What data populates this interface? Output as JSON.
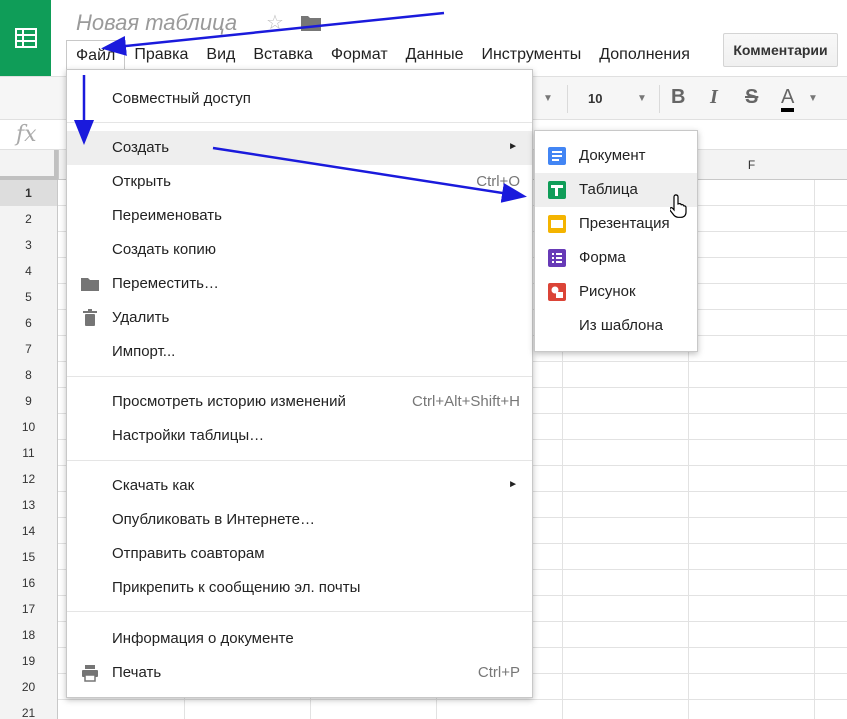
{
  "app": {
    "title": "Новая таблица"
  },
  "colors": {
    "sheets_green": "#0f9d58",
    "doc_blue": "#4285f4",
    "slides_yellow": "#f4b400",
    "forms_purple": "#673ab7",
    "drawing_red": "#db4437",
    "annotation_blue": "#1a1adc"
  },
  "menubar": {
    "items": [
      "Файл",
      "Правка",
      "Вид",
      "Вставка",
      "Формат",
      "Данные",
      "Инструменты",
      "Дополнения"
    ],
    "comments_label": "Комментарии"
  },
  "toolbar": {
    "font_size": "10",
    "bold": "B",
    "italic": "I",
    "strike": "S",
    "text_color": "A"
  },
  "formula_bar": {
    "fx_label": "fx"
  },
  "grid": {
    "column_headers": [
      "",
      "",
      "",
      "",
      "",
      "F"
    ],
    "row_numbers": [
      "1",
      "2",
      "3",
      "4",
      "5",
      "6",
      "7",
      "8",
      "9",
      "10",
      "11",
      "12",
      "13",
      "14",
      "15",
      "16",
      "17",
      "18",
      "19",
      "20",
      "21"
    ]
  },
  "file_menu": {
    "items": [
      {
        "label": "Совместный доступ",
        "shortcut": "",
        "icon": "",
        "submenu": false
      },
      {
        "label": "Создать",
        "shortcut": "",
        "icon": "",
        "submenu": true
      },
      {
        "label": "Открыть",
        "shortcut": "Ctrl+O",
        "icon": "",
        "submenu": false
      },
      {
        "label": "Переименовать",
        "shortcut": "",
        "icon": "",
        "submenu": false
      },
      {
        "label": "Создать копию",
        "shortcut": "",
        "icon": "",
        "submenu": false
      },
      {
        "label": "Переместить…",
        "shortcut": "",
        "icon": "folder-icon",
        "submenu": false
      },
      {
        "label": "Удалить",
        "shortcut": "",
        "icon": "trash-icon",
        "submenu": false
      },
      {
        "label": "Импорт...",
        "shortcut": "",
        "icon": "",
        "submenu": false
      },
      {
        "label": "Просмотреть историю изменений",
        "shortcut": "Ctrl+Alt+Shift+H",
        "icon": "",
        "submenu": false
      },
      {
        "label": "Настройки таблицы…",
        "shortcut": "",
        "icon": "",
        "submenu": false
      },
      {
        "label": "Скачать как",
        "shortcut": "",
        "icon": "",
        "submenu": true
      },
      {
        "label": "Опубликовать в Интернете…",
        "shortcut": "",
        "icon": "",
        "submenu": false
      },
      {
        "label": "Отправить соавторам",
        "shortcut": "",
        "icon": "",
        "submenu": false
      },
      {
        "label": "Прикрепить к сообщению эл. почты",
        "shortcut": "",
        "icon": "",
        "submenu": false
      },
      {
        "label": "Информация о документе",
        "shortcut": "",
        "icon": "",
        "submenu": false
      },
      {
        "label": "Печать",
        "shortcut": "Ctrl+P",
        "icon": "printer-icon",
        "submenu": false
      }
    ]
  },
  "create_submenu": {
    "items": [
      {
        "label": "Документ",
        "icon": "docs-icon"
      },
      {
        "label": "Таблица",
        "icon": "sheets-icon"
      },
      {
        "label": "Презентация",
        "icon": "slides-icon"
      },
      {
        "label": "Форма",
        "icon": "forms-icon"
      },
      {
        "label": "Рисунок",
        "icon": "drawings-icon"
      },
      {
        "label": "Из шаблона",
        "icon": ""
      }
    ]
  }
}
